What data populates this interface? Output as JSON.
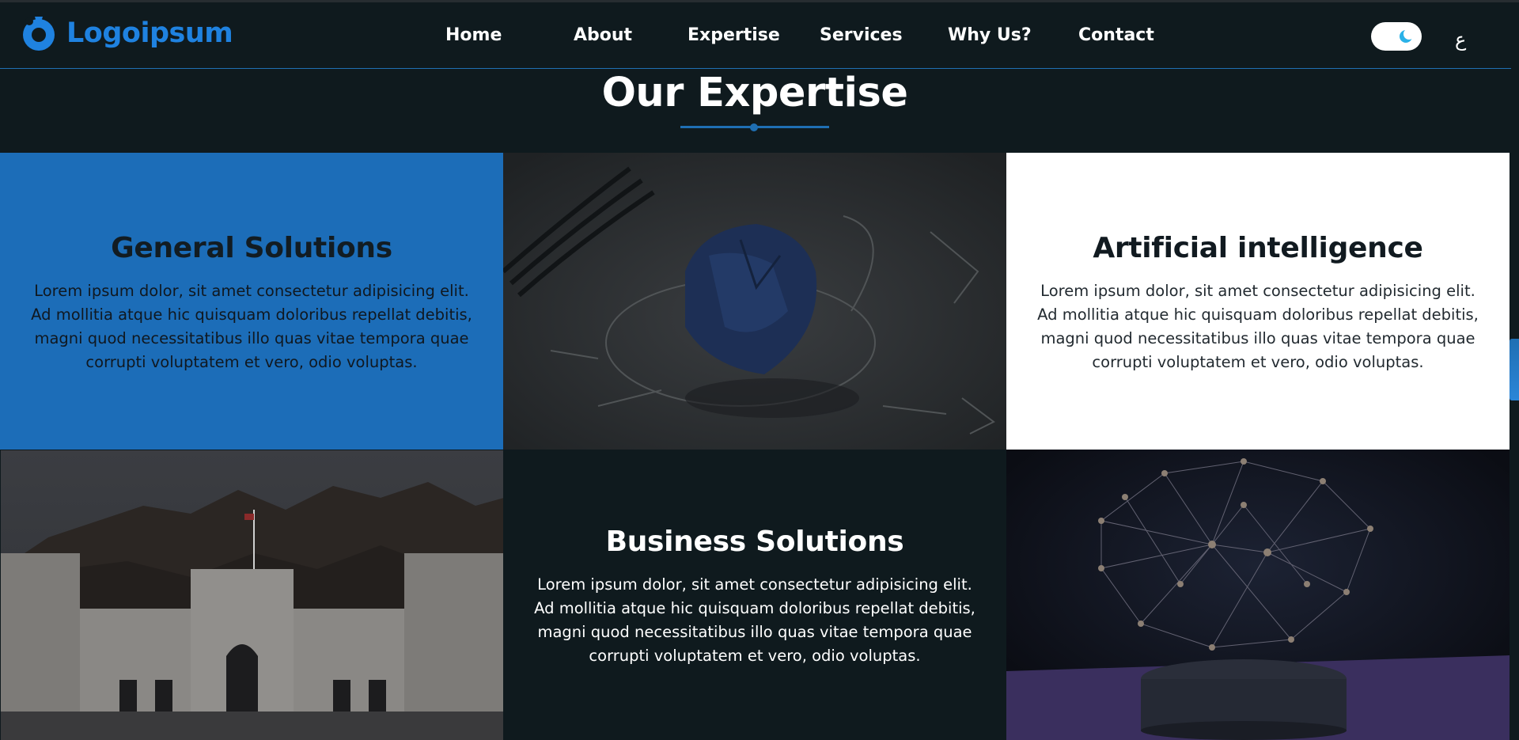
{
  "brand": {
    "name": "Logoipsum",
    "logo_icon": "logo-ring-icon",
    "accent": "#1f82e0"
  },
  "nav": {
    "items": [
      {
        "label": "Home"
      },
      {
        "label": "About"
      },
      {
        "label": "Expertise"
      },
      {
        "label": "Services"
      },
      {
        "label": "Why Us?"
      },
      {
        "label": "Contact"
      }
    ],
    "theme_toggle_icon": "moon-icon",
    "language_label": "ع"
  },
  "section": {
    "title": "Our Expertise"
  },
  "cards": [
    {
      "title": "General Solutions",
      "text": "Lorem ipsum dolor, sit amet consectetur adipisicing elit. Ad mollitia atque hic quisquam doloribus repellat debitis, magni quod necessitatibus illo quas vitae tempora quae corrupti voluptatem et vero, odio voluptas."
    },
    {
      "title": "Artificial intelligence",
      "text": "Lorem ipsum dolor, sit amet consectetur adipisicing elit. Ad mollitia atque hic quisquam doloribus repellat debitis, magni quod necessitatibus illo quas vitae tempora quae corrupti voluptatem et vero, odio voluptas."
    },
    {
      "title": "Business Solutions",
      "text": "Lorem ipsum dolor, sit amet consectetur adipisicing elit. Ad mollitia atque hic quisquam doloribus repellat debitis, magni quod necessitatibus illo quas vitae tempora quae corrupti voluptatem et vero, odio voluptas."
    }
  ],
  "images": [
    {
      "name": "crumpled-paper-lightbulb-image"
    },
    {
      "name": "palace-building-image"
    },
    {
      "name": "ai-network-brain-image"
    }
  ],
  "colors": {
    "primary": "#1c6db8",
    "background": "#0f1a1e",
    "white": "#ffffff"
  }
}
